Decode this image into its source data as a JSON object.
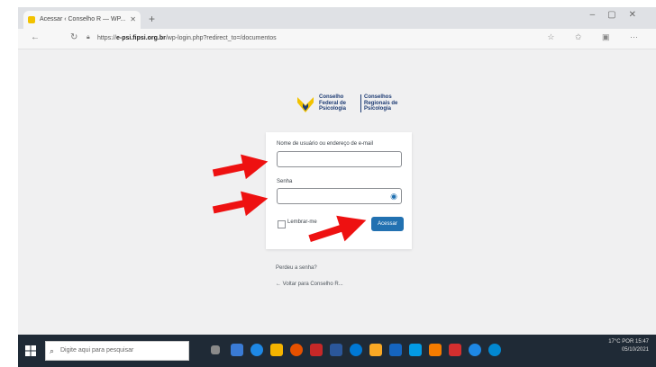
{
  "browser": {
    "tab_title": "Acessar ‹ Conselho R — WP...",
    "new_tab_symbol": "+",
    "url_domain": "e-psi.fipsi.org.br",
    "url_prefix": "https://",
    "url_rest": "/wp-login.php?redirect_to=/documentos"
  },
  "logo": {
    "org_left": "Conselho Federal de Psicologia",
    "org_right": "Conselhos Regionais de Psicologia"
  },
  "login": {
    "username_label": "Nome de usuário ou endereço de e-mail",
    "username_value": "",
    "password_label": "Senha",
    "password_value": "",
    "remember_label": "Lembrar-me",
    "submit_label": "Acessar",
    "lost_password": "Perdeu a senha?",
    "back_link": "← Voltar para Conselho R..."
  },
  "taskbar": {
    "search_placeholder": "Digite aqui para pesquisar",
    "weather": "17°C",
    "time": "15:47",
    "date": "05/10/2021",
    "lang": "POR"
  },
  "colors": {
    "primary_button": "#2271b1",
    "arrow": "#ee1111",
    "page_bg": "#f0f0f1",
    "logo_yellow": "#f2c200"
  }
}
